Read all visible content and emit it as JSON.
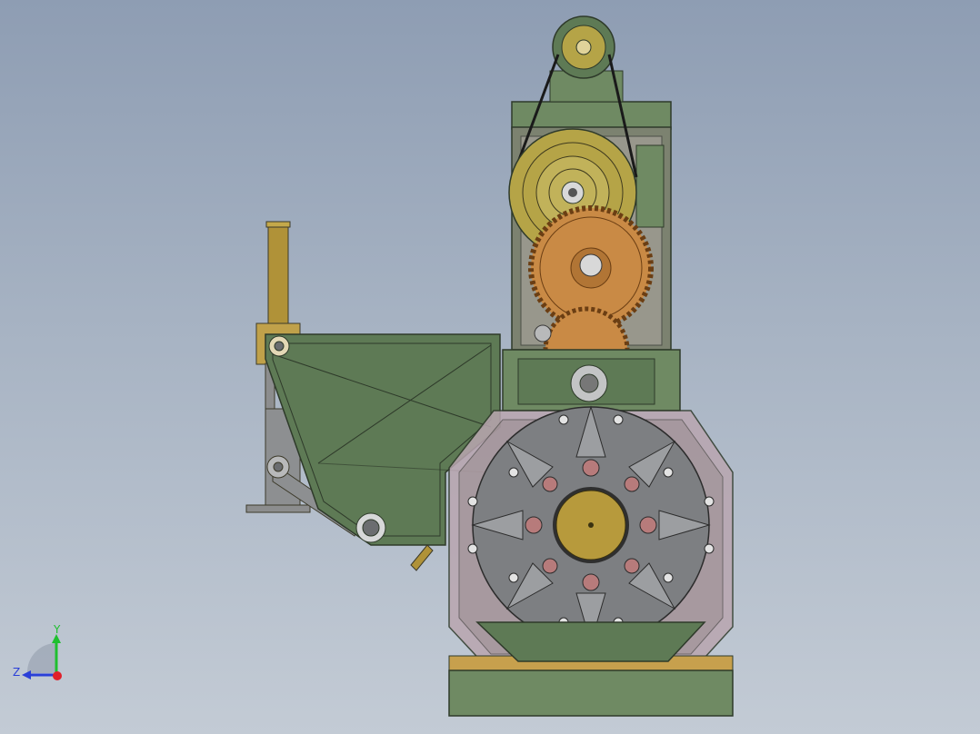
{
  "triad": {
    "y_label": "Y",
    "z_label": "Z",
    "x_color": "#e0202a",
    "y_color": "#1fbf2f",
    "z_color": "#2a3fd8"
  },
  "colors": {
    "background_top": "#8e9db3",
    "background_bottom": "#c3cbd5",
    "housing_green": "#5e7a55",
    "gear_bronze": "#c98a45",
    "pulley_gold": "#b5a447",
    "disk_gray": "#7d7f82",
    "hub_gold": "#b79a3c",
    "glass_pink": "#b9a6b0"
  }
}
